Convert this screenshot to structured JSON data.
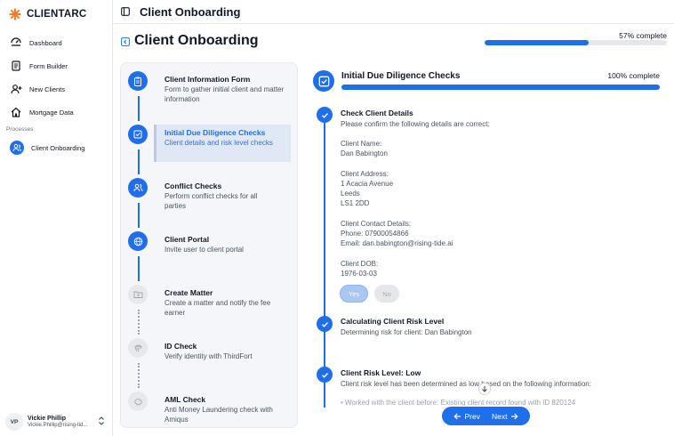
{
  "brand": {
    "name": "CLIENTARC"
  },
  "sidebar": {
    "items": [
      {
        "label": "Dashboard",
        "icon": "dashboard-icon"
      },
      {
        "label": "Form Builder",
        "icon": "form-icon"
      },
      {
        "label": "New Clients",
        "icon": "add-user-icon"
      },
      {
        "label": "Mortgage Data",
        "icon": "home-icon"
      }
    ],
    "section_label": "Processes",
    "process_items": [
      {
        "label": "Client Onboarding",
        "icon": "users-icon",
        "active": true
      }
    ]
  },
  "user": {
    "initials": "VP",
    "name": "Vickie Phillip",
    "email": "Vickie.Phillip@rising-tid..."
  },
  "topbar": {
    "title": "Client Onboarding"
  },
  "header": {
    "title": "Client Onboarding",
    "progress_label": "57% complete",
    "progress": 0.57
  },
  "steps": [
    {
      "title": "Client Information Form",
      "desc": "Form to gather initial client and matter information",
      "status": "done",
      "icon": "clipboard-icon"
    },
    {
      "title": "Initial Due Diligence Checks",
      "desc": "Client details and risk level checks",
      "status": "current",
      "icon": "checkbox-icon"
    },
    {
      "title": "Conflict Checks",
      "desc": "Perform conflict checks for all parties",
      "status": "done",
      "icon": "users-icon"
    },
    {
      "title": "Client Portal",
      "desc": "Invite user to client portal",
      "status": "done",
      "icon": "globe-icon"
    },
    {
      "title": "Create Matter",
      "desc": "Create a matter and notify the fee earner",
      "status": "todo",
      "icon": "folder-icon"
    },
    {
      "title": "ID Check",
      "desc": "Verify identity with ThirdFort",
      "status": "todo",
      "icon": "fingerprint-icon"
    },
    {
      "title": "AML Check",
      "desc": "Anti Money Laundering check with Amiqus",
      "status": "todo",
      "icon": "piggy-bank-icon"
    }
  ],
  "detail": {
    "title": "Initial Due Diligence Checks",
    "progress_label": "100% complete",
    "progress": 1.0,
    "check1": {
      "title": "Check Client Details",
      "intro": "Please confirm the following details are correct:",
      "name_label": "Client Name:",
      "name_value": "Dan Babington",
      "address_label": "Client Address:",
      "address_lines": [
        "1 Acacia Avenue",
        "Leeds",
        "LS1 2DD"
      ],
      "contact_label": "Client Contact Details:",
      "phone": "Phone: 07900054866",
      "email": "Email: dan.babington@rising-tide.ai",
      "dob_label": "Client DOB:",
      "dob_value": "1976-03-03",
      "yes_label": "Yes",
      "no_label": "No"
    },
    "check2": {
      "title": "Calculating Client Risk Level",
      "text": "Determining risk for client: Dan Babington"
    },
    "check3": {
      "title": "Client Risk Level: Low",
      "text": "Client risk level has been determined as low based on the following information:",
      "bullet": "• Worked with the client before: Existing client record found with ID 820124"
    }
  },
  "pager": {
    "prev_label": "Prev",
    "next_label": "Next"
  },
  "colors": {
    "accent": "#1f6feb",
    "panel": "#f4f6f9"
  }
}
